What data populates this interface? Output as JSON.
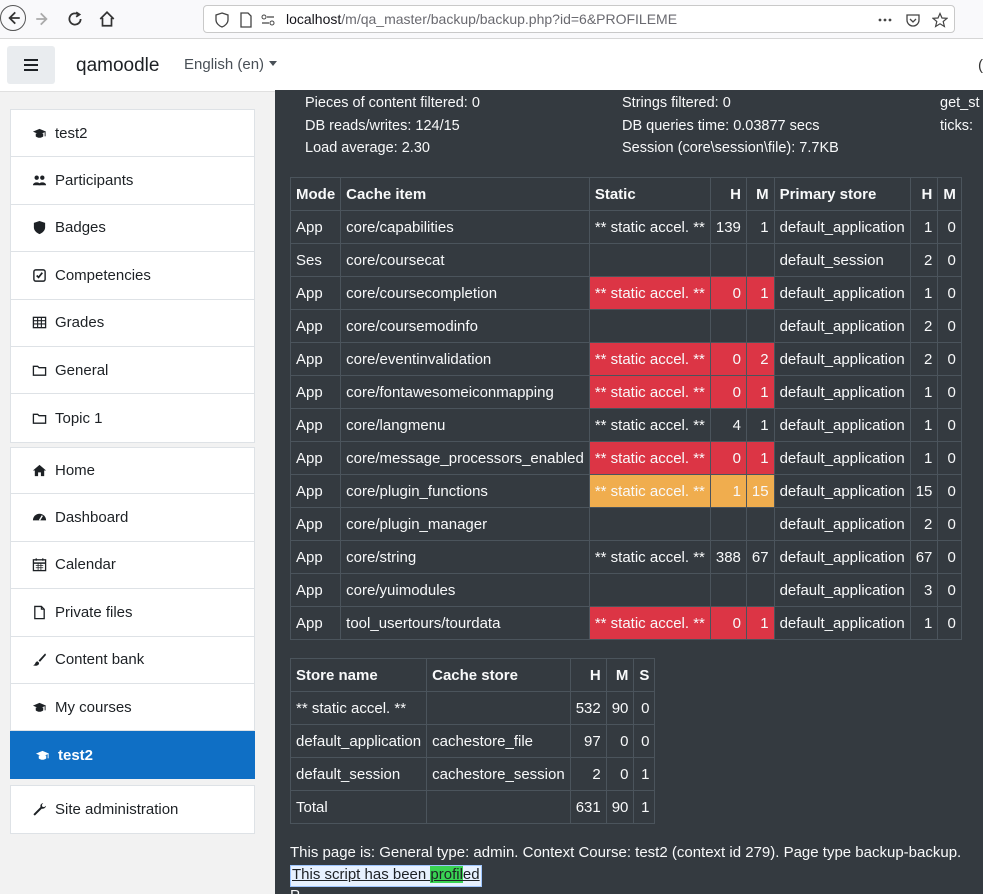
{
  "browser": {
    "url_host": "localhost",
    "url_path": "/m/qa_master/backup/backup.php?id=6&PROFILEME"
  },
  "navbar": {
    "site_name": "qamoodle",
    "language": "English (en)",
    "edge_fragment": "("
  },
  "drawer": {
    "course_items": [
      {
        "label": "test2",
        "icon": "graduation-cap-icon"
      },
      {
        "label": "Participants",
        "icon": "users-icon"
      },
      {
        "label": "Badges",
        "icon": "shield-icon"
      },
      {
        "label": "Competencies",
        "icon": "check-square-icon"
      },
      {
        "label": "Grades",
        "icon": "table-icon"
      },
      {
        "label": "General",
        "icon": "folder-icon"
      },
      {
        "label": "Topic 1",
        "icon": "folder-icon"
      }
    ],
    "site_items": [
      {
        "label": "Home",
        "icon": "home-icon"
      },
      {
        "label": "Dashboard",
        "icon": "dashboard-icon"
      },
      {
        "label": "Calendar",
        "icon": "calendar-icon"
      },
      {
        "label": "Private files",
        "icon": "file-icon"
      },
      {
        "label": "Content bank",
        "icon": "paint-brush-icon"
      },
      {
        "label": "My courses",
        "icon": "graduation-cap-icon"
      },
      {
        "label": "test2",
        "icon": "graduation-cap-icon",
        "active": true
      }
    ],
    "admin_item": {
      "label": "Site administration",
      "icon": "wrench-icon"
    }
  },
  "perf": {
    "c1": [
      "Pieces of content filtered: 0",
      "DB reads/writes: 124/15",
      "Load average: 2.30"
    ],
    "c2": [
      "Strings filtered: 0",
      "DB queries time: 0.03877 secs",
      "Session (core\\session\\file): 7.7KB"
    ],
    "c3": [
      "get_st",
      "ticks: "
    ]
  },
  "cache_table": {
    "headers": [
      "Mode",
      "Cache item",
      "Static",
      "H",
      "M",
      "Primary store",
      "H",
      "M"
    ],
    "rows": [
      {
        "mode": "App",
        "item": "core/capabilities",
        "static": "** static accel. **",
        "h": "139",
        "m": "1",
        "store": "default_application",
        "ph": "1",
        "pm": "0",
        "status": ""
      },
      {
        "mode": "Ses",
        "item": "core/coursecat",
        "static": "",
        "h": "",
        "m": "",
        "store": "default_session",
        "ph": "2",
        "pm": "0",
        "status": ""
      },
      {
        "mode": "App",
        "item": "core/coursecompletion",
        "static": "** static accel. **",
        "h": "0",
        "m": "1",
        "store": "default_application",
        "ph": "1",
        "pm": "0",
        "status": "red"
      },
      {
        "mode": "App",
        "item": "core/coursemodinfo",
        "static": "",
        "h": "",
        "m": "",
        "store": "default_application",
        "ph": "2",
        "pm": "0",
        "status": ""
      },
      {
        "mode": "App",
        "item": "core/eventinvalidation",
        "static": "** static accel. **",
        "h": "0",
        "m": "2",
        "store": "default_application",
        "ph": "2",
        "pm": "0",
        "status": "red"
      },
      {
        "mode": "App",
        "item": "core/fontawesomeiconmapping",
        "static": "** static accel. **",
        "h": "0",
        "m": "1",
        "store": "default_application",
        "ph": "1",
        "pm": "0",
        "status": "red"
      },
      {
        "mode": "App",
        "item": "core/langmenu",
        "static": "** static accel. **",
        "h": "4",
        "m": "1",
        "store": "default_application",
        "ph": "1",
        "pm": "0",
        "status": ""
      },
      {
        "mode": "App",
        "item": "core/message_processors_enabled",
        "static": "** static accel. **",
        "h": "0",
        "m": "1",
        "store": "default_application",
        "ph": "1",
        "pm": "0",
        "status": "red"
      },
      {
        "mode": "App",
        "item": "core/plugin_functions",
        "static": "** static accel. **",
        "h": "1",
        "m": "15",
        "store": "default_application",
        "ph": "15",
        "pm": "0",
        "status": "warn"
      },
      {
        "mode": "App",
        "item": "core/plugin_manager",
        "static": "",
        "h": "",
        "m": "",
        "store": "default_application",
        "ph": "2",
        "pm": "0",
        "status": ""
      },
      {
        "mode": "App",
        "item": "core/string",
        "static": "** static accel. **",
        "h": "388",
        "m": "67",
        "store": "default_application",
        "ph": "67",
        "pm": "0",
        "status": ""
      },
      {
        "mode": "App",
        "item": "core/yuimodules",
        "static": "",
        "h": "",
        "m": "",
        "store": "default_application",
        "ph": "3",
        "pm": "0",
        "status": ""
      },
      {
        "mode": "App",
        "item": "tool_usertours/tourdata",
        "static": "** static accel. **",
        "h": "0",
        "m": "1",
        "store": "default_application",
        "ph": "1",
        "pm": "0",
        "status": "red"
      }
    ]
  },
  "store_table": {
    "headers": [
      "Store name",
      "Cache store",
      "H",
      "M",
      "S"
    ],
    "rows": [
      {
        "name": "** static accel. **",
        "store": "",
        "h": "532",
        "m": "90",
        "s": "0"
      },
      {
        "name": "default_application",
        "store": "cachestore_file",
        "h": "97",
        "m": "0",
        "s": "0"
      },
      {
        "name": "default_session",
        "store": "cachestore_session",
        "h": "2",
        "m": "0",
        "s": "1"
      },
      {
        "name": "Total",
        "store": "",
        "h": "631",
        "m": "90",
        "s": "1"
      }
    ]
  },
  "footer": {
    "page_info": "This page is: General type: admin. Context Course: test2 (context id 279). Page type backup-backup.",
    "profiled_pre": "This script has been ",
    "profiled_hl": "profil",
    "profiled_post": "ed",
    "cut_text": "P"
  },
  "colors": {
    "accent": "#0f6fc5",
    "danger": "#dc3545",
    "warning": "#f0ad4e",
    "dark_bg": "#343a40",
    "highlight": "#39d353"
  }
}
